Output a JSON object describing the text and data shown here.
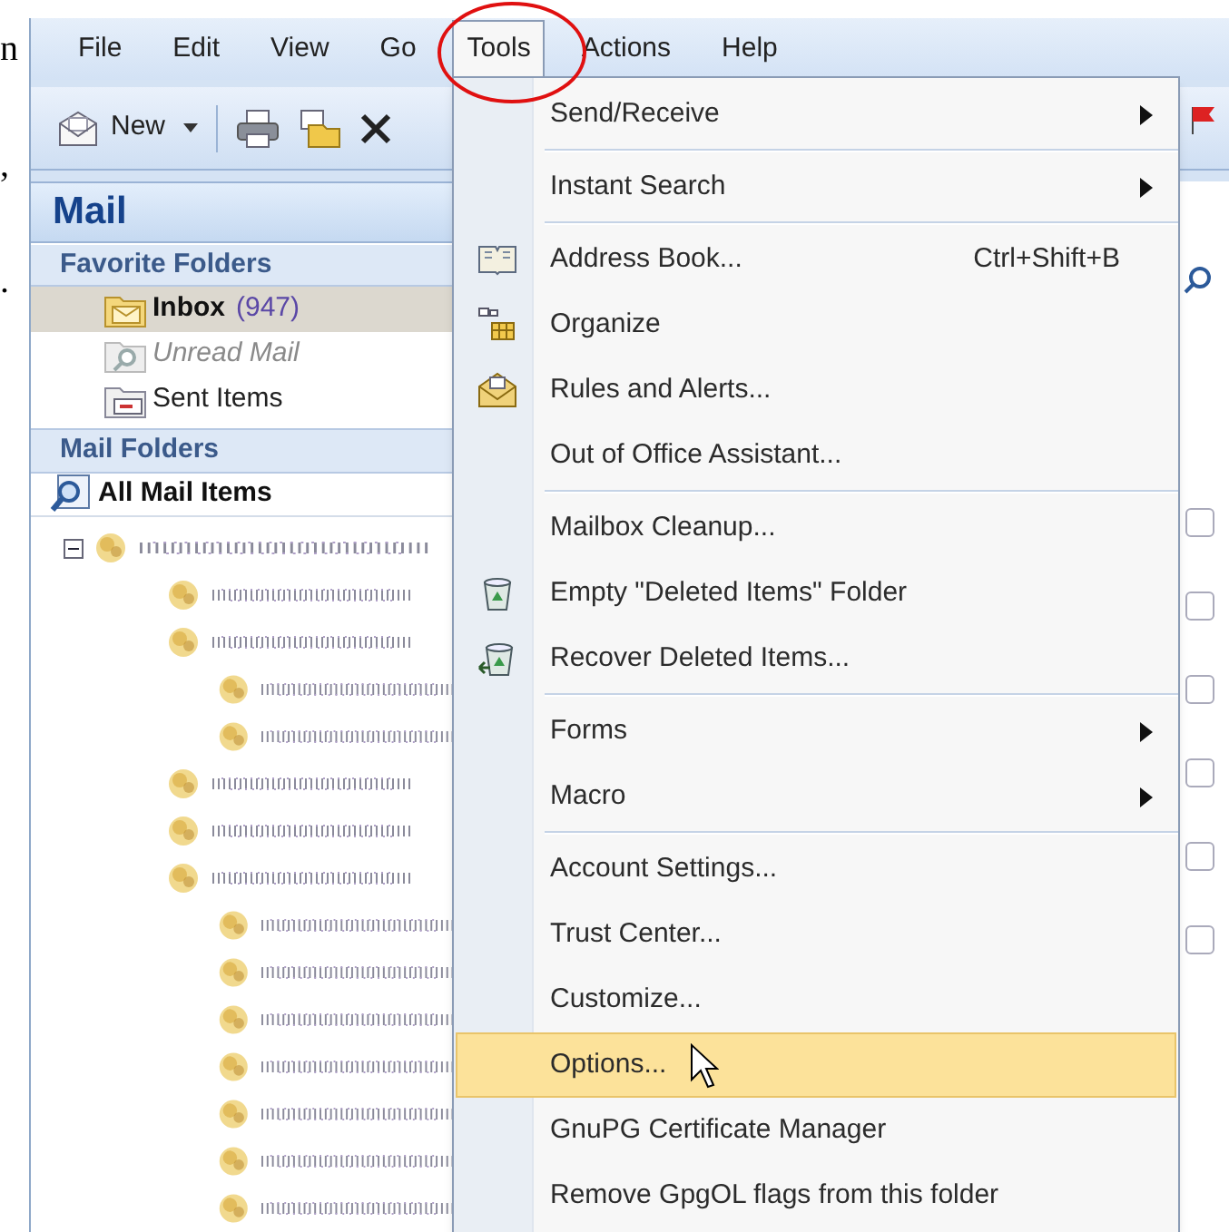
{
  "document_margin_text": [
    "n",
    ",",
    "."
  ],
  "menu_bar": [
    {
      "label": "File",
      "selected": false
    },
    {
      "label": "Edit",
      "selected": false
    },
    {
      "label": "View",
      "selected": false
    },
    {
      "label": "Go",
      "selected": false
    },
    {
      "label": "Tools",
      "selected": true
    },
    {
      "label": "Actions",
      "selected": false
    },
    {
      "label": "Help",
      "selected": false
    }
  ],
  "toolbar": {
    "new_button": {
      "label": "New"
    }
  },
  "navigation_pane": {
    "title": "Mail",
    "favorite_folders": {
      "title": "Favorite Folders",
      "items": [
        {
          "label": "Inbox",
          "count": "(947)",
          "selected": true,
          "kind": "inbox"
        },
        {
          "label": "Unread Mail",
          "selected": false,
          "kind": "search"
        },
        {
          "label": "Sent Items",
          "selected": false,
          "kind": "sent"
        }
      ]
    },
    "mail_folders": {
      "title": "Mail Folders",
      "all_items": "All Mail Items",
      "tree": [
        {
          "kind": "scrambled",
          "expanded": true,
          "children": [
            {
              "kind": "scrambled"
            },
            {
              "kind": "scrambled",
              "children": [
                {
                  "kind": "scrambled"
                },
                {
                  "kind": "scrambled"
                }
              ]
            },
            {
              "kind": "scrambled"
            },
            {
              "kind": "scrambled"
            },
            {
              "kind": "scrambled",
              "children": [
                {
                  "kind": "scrambled"
                },
                {
                  "kind": "scrambled"
                },
                {
                  "kind": "scrambled"
                },
                {
                  "kind": "scrambled"
                },
                {
                  "kind": "scrambled"
                },
                {
                  "kind": "scrambled"
                },
                {
                  "kind": "scrambled"
                }
              ]
            }
          ]
        }
      ]
    }
  },
  "message_flags": [
    {
      "checked": false
    },
    {
      "checked": false
    },
    {
      "checked": false
    },
    {
      "checked": false
    },
    {
      "checked": false
    },
    {
      "checked": false
    }
  ],
  "tools_menu": [
    {
      "kind": "submenu",
      "label": "Send/Receive",
      "selected": false
    },
    {
      "kind": "separator"
    },
    {
      "kind": "submenu",
      "label": "Instant Search",
      "selected": false
    },
    {
      "kind": "separator"
    },
    {
      "kind": "item",
      "label": "Address Book...",
      "shortcut": "Ctrl+Shift+B",
      "icon": true,
      "selected": false
    },
    {
      "kind": "item",
      "label": "Organize",
      "icon": true,
      "selected": false
    },
    {
      "kind": "item",
      "label": "Rules and Alerts...",
      "icon": true,
      "selected": false
    },
    {
      "kind": "item",
      "label": "Out of Office Assistant...",
      "selected": false
    },
    {
      "kind": "separator"
    },
    {
      "kind": "item",
      "label": "Mailbox Cleanup...",
      "selected": false
    },
    {
      "kind": "item",
      "label": "Empty \"Deleted Items\" Folder",
      "icon": true,
      "selected": false
    },
    {
      "kind": "item",
      "label": "Recover Deleted Items...",
      "icon": true,
      "selected": false
    },
    {
      "kind": "separator"
    },
    {
      "kind": "submenu",
      "label": "Forms",
      "selected": false
    },
    {
      "kind": "submenu",
      "label": "Macro",
      "selected": false
    },
    {
      "kind": "separator"
    },
    {
      "kind": "item",
      "label": "Account Settings...",
      "selected": false
    },
    {
      "kind": "item",
      "label": "Trust Center...",
      "selected": false
    },
    {
      "kind": "item",
      "label": "Customize...",
      "selected": false
    },
    {
      "kind": "item",
      "label": "Options...",
      "selected": true
    },
    {
      "kind": "item",
      "label": "GnuPG Certificate Manager",
      "selected": false
    },
    {
      "kind": "item",
      "label": "Remove GpgOL flags from this folder",
      "selected": false
    }
  ]
}
